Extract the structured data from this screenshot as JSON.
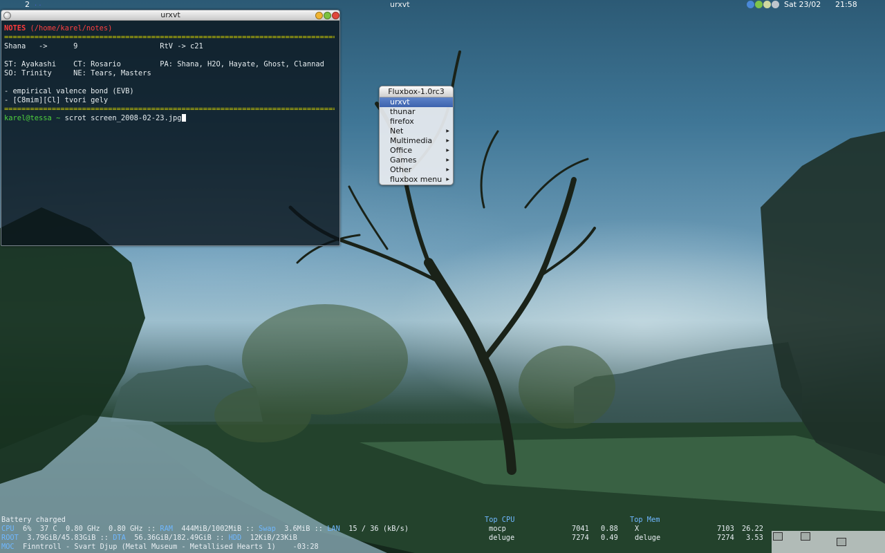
{
  "topbar": {
    "workspace": "2",
    "workspace_dots": ". .",
    "focused_title": "urxvt",
    "date": "Sat 23/02",
    "time": "21:58",
    "tray_colors": [
      "#4a88d8",
      "#7ec34a",
      "#cfd8a0",
      "#bfc5cc"
    ]
  },
  "terminal": {
    "title": "urxvt",
    "lines": {
      "notes_label": "NOTES",
      "notes_path": " (/home/karel/notes)",
      "sep1": "==============================================================================",
      "l1": "Shana   ->      9                   RtV -> c21",
      "l2": "ST: Ayakashi    CT: Rosario         PA: Shana, H2O, Hayate, Ghost, Clannad",
      "l3": "SO: Trinity     NE: Tears, Masters",
      "l4": "- empirical valence bond (EVB)",
      "l5": "- [C8mim][Cl] tvori gely",
      "sep2": "==============================================================================",
      "prompt_user": "karel@tessa ~",
      "command": " scrot screen_2008-02-23.jpg"
    }
  },
  "root_menu": {
    "title": "Fluxbox-1.0rc3",
    "items": [
      {
        "label": "urxvt",
        "submenu": false
      },
      {
        "label": "thunar",
        "submenu": false
      },
      {
        "label": "firefox",
        "submenu": false
      },
      {
        "label": "Net",
        "submenu": true
      },
      {
        "label": "Multimedia",
        "submenu": true
      },
      {
        "label": "Office",
        "submenu": true
      },
      {
        "label": "Games",
        "submenu": true
      },
      {
        "label": "Other",
        "submenu": true
      },
      {
        "label": "fluxbox menu",
        "submenu": true
      }
    ],
    "arrow": "▶"
  },
  "conky": {
    "battery": "Battery charged",
    "cpu_label": "CPU",
    "cpu_vals": "  6%  37 C  0.80 GHz  0.80 GHz :: ",
    "ram_label": "RAM",
    "ram_vals": "  444MiB/1002MiB :: ",
    "swap_label": "Swap",
    "swap_vals": "  3.6MiB :: ",
    "lan_label": "LAN",
    "lan_vals": "  15 / 36 (kB/s)",
    "root_label": "ROOT",
    "root_vals": "  3.79GiB/45.83GiB :: ",
    "dta_label": "DTA",
    "dta_vals": "  56.36GiB/182.49GiB :: ",
    "hdd_label": "HDD",
    "hdd_vals": "  12KiB/23KiB",
    "moc_label": "MOC",
    "moc_vals": "  Finntroll - Svart Djup (Metal Museum - Metallised Hearts 1)    -03:28",
    "top_cpu_label": "Top CPU",
    "top_cpu": [
      {
        "name": "mocp",
        "pid": "7041",
        "val": "0.88"
      },
      {
        "name": "deluge",
        "pid": "7274",
        "val": "0.49"
      }
    ],
    "top_mem_label": "Top Mem",
    "top_mem": [
      {
        "name": "X",
        "pid": "7103",
        "val": "26.22"
      },
      {
        "name": "deluge",
        "pid": "7274",
        "val": "3.53"
      }
    ]
  }
}
